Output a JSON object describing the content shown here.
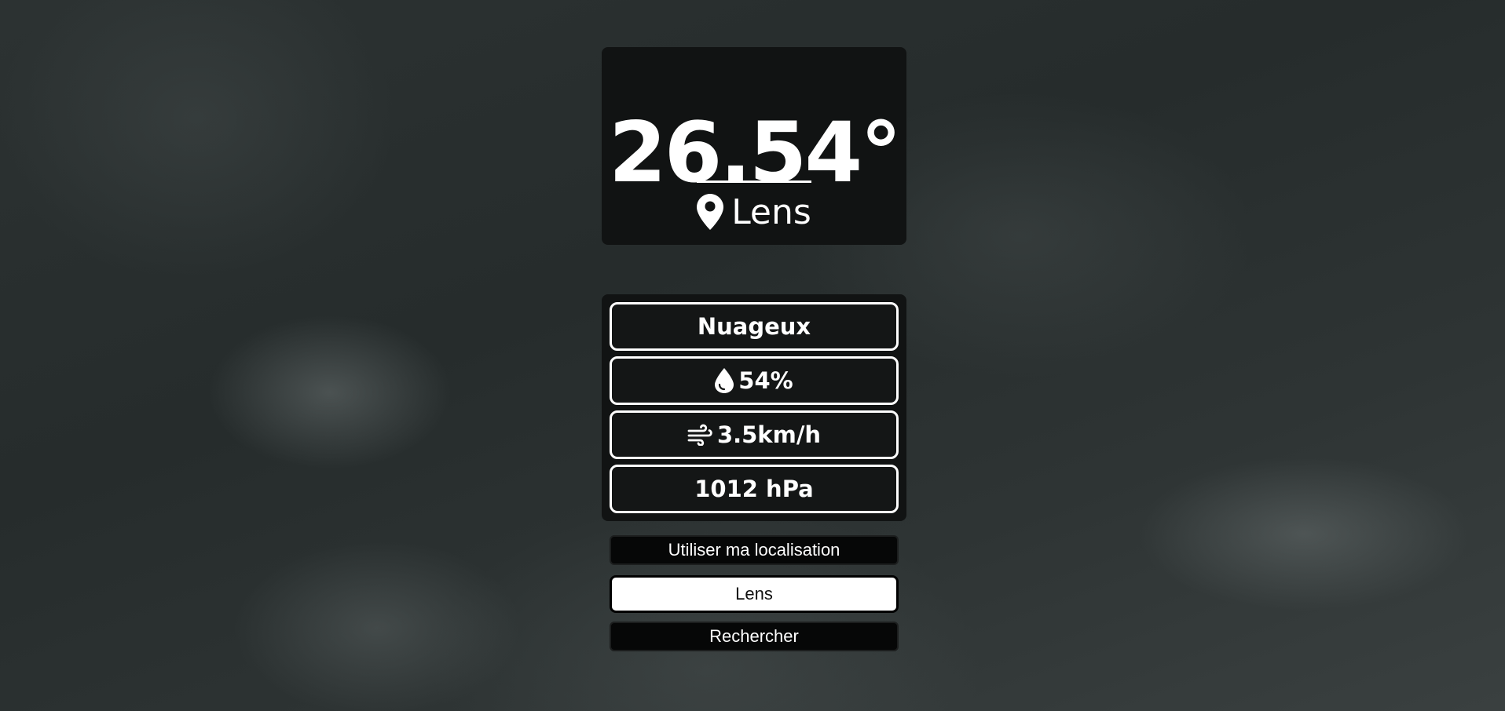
{
  "weather": {
    "temperature": "26.54°",
    "location": "Lens",
    "condition": "Nuageux",
    "humidity": "54%",
    "wind": "3.5km/h",
    "pressure": "1012 hPa"
  },
  "icons": {
    "location": "map-pin-icon",
    "humidity": "water-drop-icon",
    "wind": "wind-icon"
  },
  "controls": {
    "use_location_label": "Utiliser ma localisation",
    "search_value": "Lens",
    "search_label": "Rechercher"
  },
  "colors": {
    "card_background": "#111313",
    "text": "#ffffff"
  }
}
